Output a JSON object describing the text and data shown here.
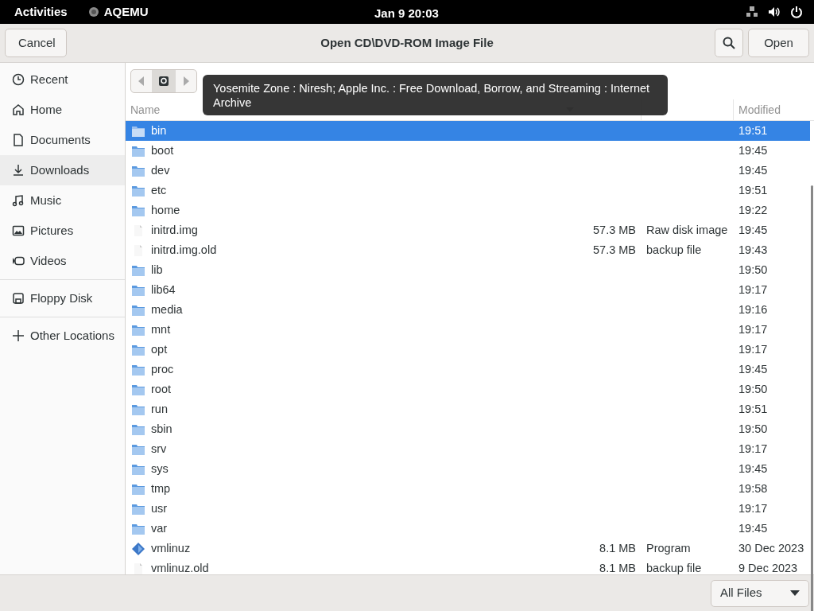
{
  "top_bar": {
    "activities": "Activities",
    "app": "AQEMU",
    "clock": "Jan 9  20:03"
  },
  "header_bar": {
    "cancel": "Cancel",
    "title": "Open CD\\DVD-ROM Image File",
    "open": "Open"
  },
  "sidebar": {
    "items": [
      {
        "label": "Recent",
        "hovered": false
      },
      {
        "label": "Home",
        "hovered": false
      },
      {
        "label": "Documents",
        "hovered": false
      },
      {
        "label": "Downloads",
        "hovered": true
      },
      {
        "label": "Music",
        "hovered": false
      },
      {
        "label": "Pictures",
        "hovered": false
      },
      {
        "label": "Videos",
        "hovered": false
      },
      {
        "label": "Floppy Disk",
        "hovered": false
      },
      {
        "label": "Other Locations",
        "hovered": false
      }
    ]
  },
  "tooltip": "Yosemite Zone : Niresh; Apple Inc. : Free Download, Borrow, and Streaming : Internet Archive",
  "table": {
    "columns": [
      "Name",
      "Modified"
    ],
    "rows": [
      {
        "name": "bin",
        "kind": "folder",
        "modified": "19:51",
        "selected": true
      },
      {
        "name": "boot",
        "kind": "folder",
        "modified": "19:45",
        "selected": false
      },
      {
        "name": "dev",
        "kind": "folder",
        "modified": "19:45",
        "selected": false
      },
      {
        "name": "etc",
        "kind": "folder",
        "modified": "19:51",
        "selected": false
      },
      {
        "name": "home",
        "kind": "folder",
        "modified": "19:22",
        "selected": false
      },
      {
        "name": "initrd.img",
        "kind": "file",
        "size": "57.3 MB",
        "type": "Raw disk image",
        "modified": "19:45",
        "selected": false
      },
      {
        "name": "initrd.img.old",
        "kind": "file",
        "size": "57.3 MB",
        "type": "backup file",
        "modified": "19:43",
        "selected": false
      },
      {
        "name": "lib",
        "kind": "folder",
        "modified": "19:50",
        "selected": false
      },
      {
        "name": "lib64",
        "kind": "folder",
        "modified": "19:17",
        "selected": false
      },
      {
        "name": "media",
        "kind": "folder",
        "modified": "19:16",
        "selected": false
      },
      {
        "name": "mnt",
        "kind": "folder",
        "modified": "19:17",
        "selected": false
      },
      {
        "name": "opt",
        "kind": "folder",
        "modified": "19:17",
        "selected": false
      },
      {
        "name": "proc",
        "kind": "folder",
        "modified": "19:45",
        "selected": false
      },
      {
        "name": "root",
        "kind": "folder",
        "modified": "19:50",
        "selected": false
      },
      {
        "name": "run",
        "kind": "folder",
        "modified": "19:51",
        "selected": false
      },
      {
        "name": "sbin",
        "kind": "folder",
        "modified": "19:50",
        "selected": false
      },
      {
        "name": "srv",
        "kind": "folder",
        "modified": "19:17",
        "selected": false
      },
      {
        "name": "sys",
        "kind": "folder",
        "modified": "19:45",
        "selected": false
      },
      {
        "name": "tmp",
        "kind": "folder",
        "modified": "19:58",
        "selected": false
      },
      {
        "name": "usr",
        "kind": "folder",
        "modified": "19:17",
        "selected": false
      },
      {
        "name": "var",
        "kind": "folder",
        "modified": "19:45",
        "selected": false
      },
      {
        "name": "vmlinuz",
        "kind": "program",
        "size": "8.1 MB",
        "type": "Program",
        "modified": "30 Dec 2023",
        "selected": false
      },
      {
        "name": "vmlinuz.old",
        "kind": "file",
        "size": "8.1 MB",
        "type": "backup file",
        "modified": "9 Dec 2023",
        "selected": false
      }
    ]
  },
  "filter": {
    "value": "All Files"
  }
}
